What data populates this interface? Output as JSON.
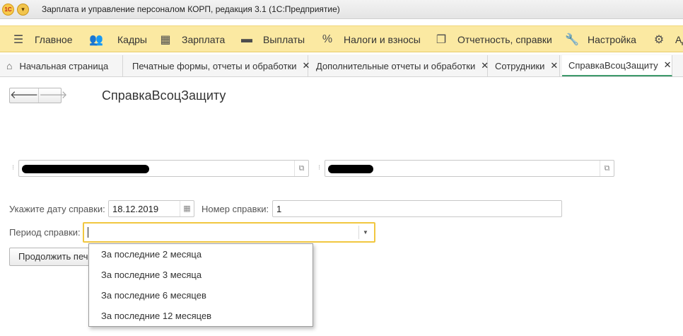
{
  "window": {
    "logo_text": "1С",
    "title": "Зарплата и управление персоналом КОРП, редакция 3.1  (1С:Предприятие)"
  },
  "main_menu": [
    {
      "label": "Главное",
      "icon": "hamburger-icon"
    },
    {
      "label": "Кадры",
      "icon": "people-icon"
    },
    {
      "label": "Зарплата",
      "icon": "calculator-icon"
    },
    {
      "label": "Выплаты",
      "icon": "wallet-icon"
    },
    {
      "label": "Налоги и взносы",
      "icon": "percent-icon"
    },
    {
      "label": "Отчетность, справки",
      "icon": "documents-icon"
    },
    {
      "label": "Настройка",
      "icon": "wrench-icon"
    },
    {
      "label": "Ад",
      "icon": "gear-icon"
    }
  ],
  "tabs": [
    {
      "label": "Начальная страница",
      "closable": false
    },
    {
      "label": "Печатные формы, отчеты и обработки",
      "closable": true
    },
    {
      "label": "Дополнительные отчеты и обработки",
      "closable": true
    },
    {
      "label": "Сотрудники",
      "closable": true
    },
    {
      "label": "СправкаВсоцЗащиту",
      "closable": true,
      "active": true
    }
  ],
  "form": {
    "title": "СправкаВсоцЗащиту",
    "date_label": "Укажите дату справки:",
    "date_value": "18.12.2019",
    "number_label": "Номер справки:",
    "number_value": "1",
    "period_label": "Период справки:",
    "period_value": "",
    "continue_button": "Продолжить печать"
  },
  "period_options": [
    "За последние 2 месяца",
    "За последние 3 месяца",
    "За последние 6 месяцев",
    "За последние 12 месяцев"
  ],
  "colors": {
    "menu_bg": "#fbe9a2",
    "active_tab_underline": "#3d9a6b",
    "focus_border": "#f1c740"
  }
}
